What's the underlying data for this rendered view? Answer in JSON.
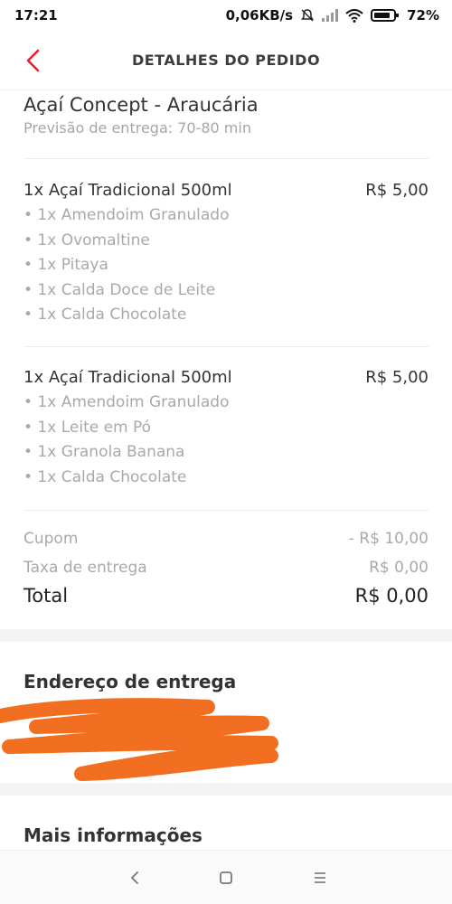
{
  "status_bar": {
    "time": "17:21",
    "network_speed": "0,06KB/s",
    "battery": "72%",
    "icons": [
      "alarm-off-icon",
      "signal-icon",
      "wifi-icon",
      "battery-icon"
    ]
  },
  "header": {
    "title": "DETALHES DO PEDIDO",
    "back_icon": "chevron-left-icon"
  },
  "store": {
    "name": "Açaí Concept - Araucária",
    "eta": "Previsão de entrega: 70-80 min"
  },
  "items": [
    {
      "title": "1x Açaí Tradicional 500ml",
      "price": "R$ 5,00",
      "options": [
        "• 1x Amendoim Granulado",
        "• 1x Ovomaltine",
        "• 1x Pitaya",
        "• 1x Calda Doce de Leite",
        "• 1x Calda Chocolate"
      ]
    },
    {
      "title": "1x Açaí Tradicional 500ml",
      "price": "R$ 5,00",
      "options": [
        "• 1x Amendoim Granulado",
        "• 1x Leite em Pó",
        "• 1x Granola Banana",
        "• 1x Calda Chocolate"
      ]
    }
  ],
  "summary": {
    "coupon_label": "Cupom",
    "coupon_value": "- R$ 10,00",
    "delivery_label": "Taxa de entrega",
    "delivery_value": "R$ 0,00",
    "total_label": "Total",
    "total_value": "R$ 0,00"
  },
  "address": {
    "title": "Endereço de entrega"
  },
  "more": {
    "title": "Mais informações"
  },
  "colors": {
    "accent": "#ea1d2c",
    "redaction": "#f26f21",
    "muted_text": "#a9a9a9",
    "band": "#f5f3f2"
  },
  "nav": {
    "icons": [
      "nav-back-icon",
      "nav-home-icon",
      "nav-menu-icon"
    ]
  }
}
